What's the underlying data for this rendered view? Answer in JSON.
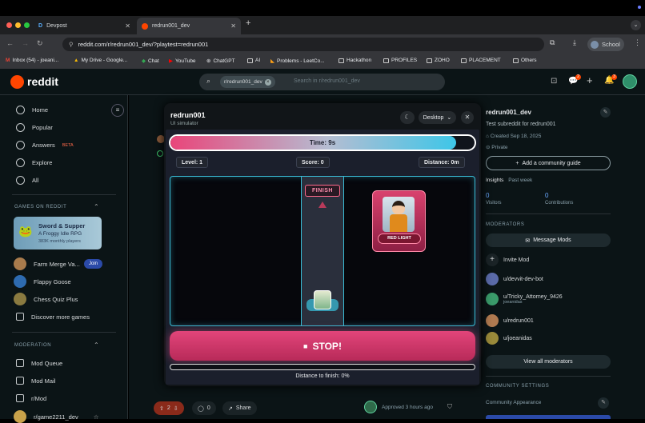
{
  "browser": {
    "tabs": [
      {
        "label": "Devpost",
        "icon": "D"
      },
      {
        "label": "redrun001_dev"
      }
    ],
    "new_tab": "+",
    "url": "reddit.com/r/redrun001_dev/?playtest=redrun001",
    "profile": "School"
  },
  "bookmarks": [
    "Inbox (54) - joeani...",
    "My Drive - Google...",
    "Chat",
    "YouTube",
    "ChatGPT",
    "AI",
    "Problems - LeetCo...",
    "Hackathon",
    "PROFILES",
    "ZOHO",
    "PLACEMENT",
    "Others"
  ],
  "reddit": {
    "logo": "reddit",
    "search_chip": "r/redrun001_dev",
    "search_placeholder": "Search in r/redrun001_dev",
    "badge1": "2",
    "badge2": "3"
  },
  "sidebar": {
    "nav": [
      "Home",
      "Popular",
      "Answers",
      "Explore",
      "All"
    ],
    "beta": "BETA",
    "games_heading": "GAMES ON REDDIT",
    "promo": {
      "title": "Sword & Supper",
      "sub": "A Froggy Idle RPG",
      "players": "383K monthly players"
    },
    "games": [
      "Farm Merge Va...",
      "Flappy Goose",
      "Chess Quiz Plus",
      "Discover more games"
    ],
    "join": "Join",
    "moderation_heading": "MODERATION",
    "mod_items": [
      "Mod Queue",
      "Mod Mail",
      "r/Mod",
      "r/game2211_dev"
    ]
  },
  "modal": {
    "title": "redrun001",
    "subtitle": "UI simulator",
    "device": "Desktop"
  },
  "game": {
    "time_label": "Time: 9s",
    "time_fraction": 0.94,
    "level": "Level: 1",
    "score": "Score: 0",
    "distance": "Distance: 0m",
    "finish": "FINISH",
    "red_light": "RED LIGHT",
    "stop": "STOP!",
    "stop_icon": "■",
    "distance_to_finish": "Distance to finish: 0%",
    "progress_fraction": 0
  },
  "post": {
    "votes": "2",
    "comments": "0",
    "share": "Share",
    "approved": "Approved 3 hours ago"
  },
  "right": {
    "name": "redrun001_dev",
    "desc": "Test subreddit for redrun001",
    "created": "Created Sep 18, 2025",
    "privacy": "Private",
    "guide_btn": "Add a community guide",
    "insights": "Insights",
    "insights_period": "Past week",
    "visitors_num": "0",
    "visitors": "Visitors",
    "contrib_num": "0",
    "contrib": "Contributions",
    "moderators": "MODERATORS",
    "message_mods": "Message Mods",
    "invite": "Invite Mod",
    "mods": [
      {
        "name": "u/devvit-dev-bot",
        "sub": ""
      },
      {
        "name": "u/Tricky_Attorney_9426",
        "sub": "joeanidas"
      },
      {
        "name": "u/redrun001",
        "sub": ""
      },
      {
        "name": "u/joeanidas",
        "sub": ""
      }
    ],
    "view_all": "View all moderators",
    "settings": "COMMUNITY SETTINGS",
    "appearance": "Community Appearance"
  },
  "colors": {
    "accent": "#e2457a",
    "cyan": "#39bcd6",
    "reddit": "#ff4500",
    "bg": "#0b1416"
  }
}
